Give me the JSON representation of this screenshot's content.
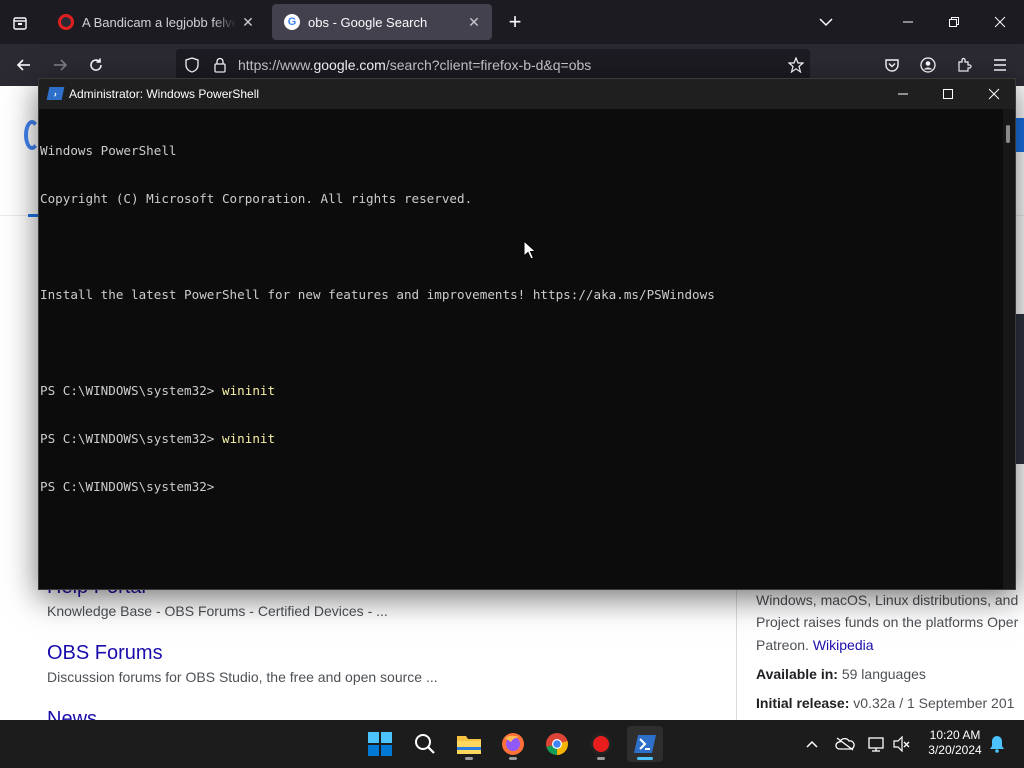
{
  "browser": {
    "tabs": [
      {
        "title": "A Bandicam a legjobb felvevőprogram",
        "active": false
      },
      {
        "title": "obs - Google Search",
        "active": true
      }
    ],
    "url_pre": "https://www.",
    "url_domain": "google.com",
    "url_post": "/search?client=firefox-b-d&q=obs"
  },
  "google": {
    "results": [
      {
        "title": "Help Portal",
        "snippet": "Knowledge Base - OBS Forums - Certified Devices - ..."
      },
      {
        "title": "OBS Forums",
        "snippet": "Discussion forums for OBS Studio, the free and open source ..."
      },
      {
        "title": "News",
        "snippet": ""
      }
    ],
    "knowledge_panel": {
      "line1": "Windows, macOS, Linux distributions, and",
      "line2": "Project raises funds on the platforms Oper",
      "line3_pre": "Patreon. ",
      "line3_link": "Wikipedia",
      "available_label": "Available in:",
      "available_value": " 59 languages",
      "initial_label": "Initial release:",
      "initial_value": " v0.32a / 1 September 201"
    }
  },
  "powershell": {
    "title": "Administrator: Windows PowerShell",
    "lines": [
      {
        "prompt": "Windows PowerShell",
        "cmd": ""
      },
      {
        "prompt": "Copyright (C) Microsoft Corporation. All rights reserved.",
        "cmd": ""
      },
      {
        "prompt": "",
        "cmd": ""
      },
      {
        "prompt": "Install the latest PowerShell for new features and improvements! https://aka.ms/PSWindows",
        "cmd": ""
      },
      {
        "prompt": "",
        "cmd": ""
      },
      {
        "prompt": "PS C:\\WINDOWS\\system32> ",
        "cmd": "wininit"
      },
      {
        "prompt": "PS C:\\WINDOWS\\system32> ",
        "cmd": "wininit"
      },
      {
        "prompt": "PS C:\\WINDOWS\\system32> ",
        "cmd": ""
      }
    ]
  },
  "taskbar": {
    "time": "10:20 AM",
    "date": "3/20/2024"
  },
  "colors": {
    "ps_background": "#0c0c0c",
    "ps_command": "#f9f1a5",
    "google_link": "#1a0dab",
    "firefox_tabbar": "#1c1b22"
  }
}
